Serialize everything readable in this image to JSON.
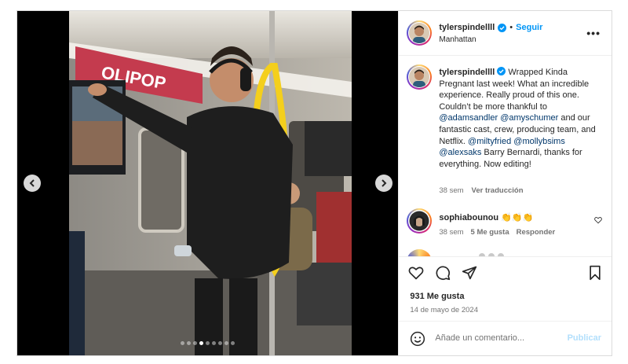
{
  "post": {
    "username": "tylerspindellll",
    "follow_label": "Seguir",
    "separator": "•",
    "location": "Manhattan",
    "more_label": "•••"
  },
  "caption": {
    "username": "tylerspindellll",
    "part1": "Wrapped Kinda Pregnant last week! What an incredible experience. Really proud of this one. Couldn’t be more thankful to ",
    "mention1": "@adamsandler",
    "space1": " ",
    "mention2": "@amyschumer",
    "part2": " and our fantastic cast, crew, producing team, and Netflix. ",
    "mention3": "@miltyfried",
    "space2": " ",
    "mention4": "@mollybsims",
    "space3": " ",
    "mention5": "@alexsaks",
    "part3": " Barry Bernardi, thanks for everything. Now editing!",
    "time": "38 sem",
    "translate_label": "Ver traducción"
  },
  "comment": {
    "username": "sophiabounou",
    "text": "👏👏👏",
    "time": "38 sem",
    "likes": "5 Me gusta",
    "reply_label": "Responder"
  },
  "stats": {
    "likes": "931 Me gusta",
    "date": "14 de mayo de 2024"
  },
  "composer": {
    "placeholder": "Añade un comentario...",
    "publish_label": "Publicar"
  },
  "carousel": {
    "total": 9,
    "active_index": 3
  },
  "photo_text": {
    "brand": "OLIPOP"
  },
  "colors": {
    "accent": "#0095f6",
    "mention": "#00376b",
    "muted": "#737373",
    "publish_disabled": "#b2dffc"
  },
  "icons": [
    "verified-icon",
    "more-icon",
    "heart-icon",
    "comment-icon",
    "share-icon",
    "bookmark-icon",
    "emoji-icon",
    "chevron-left-icon",
    "chevron-right-icon"
  ]
}
